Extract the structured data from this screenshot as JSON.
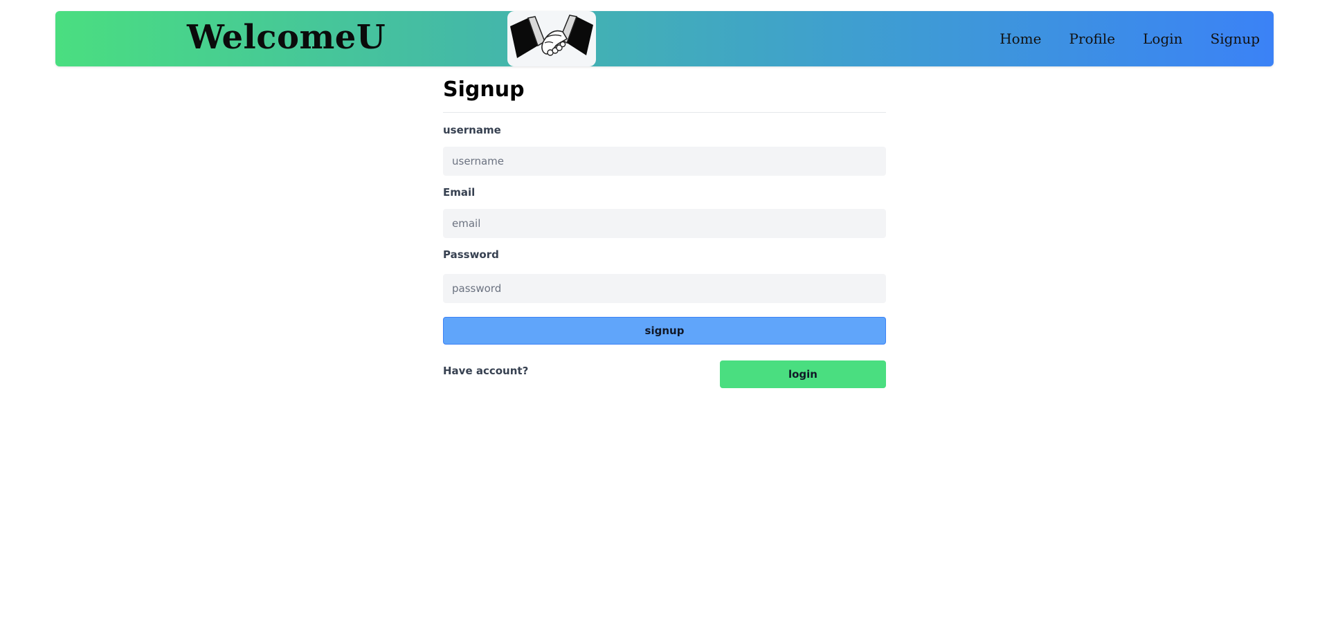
{
  "header": {
    "brand": "WelcomeU",
    "logo_icon": "handshake-icon",
    "nav": [
      {
        "label": "Home"
      },
      {
        "label": "Profile"
      },
      {
        "label": "Login"
      },
      {
        "label": "Signup"
      }
    ],
    "gradient": [
      "#4ade80",
      "#3b82f6"
    ]
  },
  "form": {
    "title": "Signup",
    "username": {
      "label": "username",
      "placeholder": "username",
      "value": ""
    },
    "email": {
      "label": "Email",
      "placeholder": "email",
      "value": ""
    },
    "password": {
      "label": "Password",
      "placeholder": "password",
      "value": ""
    },
    "submit_label": "signup",
    "have_account_text": "Have account?",
    "login_label": "login"
  },
  "colors": {
    "signup_button": "#60a5fa",
    "login_button": "#4ade80",
    "input_bg": "#f3f4f6"
  }
}
